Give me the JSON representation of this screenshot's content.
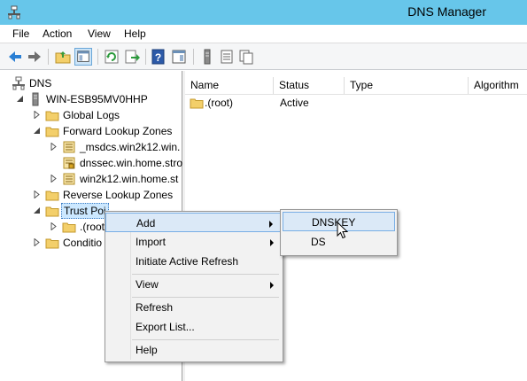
{
  "window": {
    "title": "DNS Manager"
  },
  "menubar": {
    "items": [
      "File",
      "Action",
      "View",
      "Help"
    ]
  },
  "toolbar": {
    "buttons": [
      "back-icon",
      "forward-icon",
      "up-folder-icon",
      "show-tree-icon",
      "refresh-icon",
      "export-icon",
      "help-icon",
      "properties-icon",
      "server-icon",
      "list-icon",
      "copy-icon"
    ]
  },
  "tree": {
    "items": [
      {
        "label": "DNS",
        "icon": "dns-icon"
      },
      {
        "label": "WIN-ESB95MV0HHP",
        "icon": "server-icon"
      },
      {
        "label": "Global Logs",
        "icon": "folder-icon"
      },
      {
        "label": "Forward Lookup Zones",
        "icon": "folder-icon"
      },
      {
        "label": "_msdcs.win2k12.win.",
        "icon": "zone-icon"
      },
      {
        "label": "dnssec.win.home.stro",
        "icon": "zone-icon"
      },
      {
        "label": "win2k12.win.home.st",
        "icon": "zone-icon"
      },
      {
        "label": "Reverse Lookup Zones",
        "icon": "folder-icon"
      },
      {
        "label": "Trust Poi",
        "icon": "folder-icon"
      },
      {
        "label": ".(root",
        "icon": "folder-icon"
      },
      {
        "label": "Conditio",
        "icon": "folder-icon"
      }
    ]
  },
  "list": {
    "columns": [
      "Name",
      "Status",
      "Type",
      "Algorithm"
    ],
    "rows": [
      {
        "name": ".(root)",
        "status": "Active"
      }
    ]
  },
  "context_menu": {
    "items": [
      {
        "label": "Add",
        "submenu": true
      },
      {
        "label": "Import",
        "submenu": true
      },
      {
        "label": "Initiate Active Refresh",
        "submenu": false
      },
      {
        "label": "View",
        "submenu": true
      },
      {
        "label": "Refresh",
        "submenu": false
      },
      {
        "label": "Export List...",
        "submenu": false
      },
      {
        "label": "Help",
        "submenu": false
      }
    ]
  },
  "submenu": {
    "items": [
      "DNSKEY",
      "DS"
    ]
  },
  "colors": {
    "titlebar": "#67c6ea",
    "highlight": "#dbe9f7",
    "highlight_border": "#78aee5",
    "folder": "#f3cf6a"
  }
}
